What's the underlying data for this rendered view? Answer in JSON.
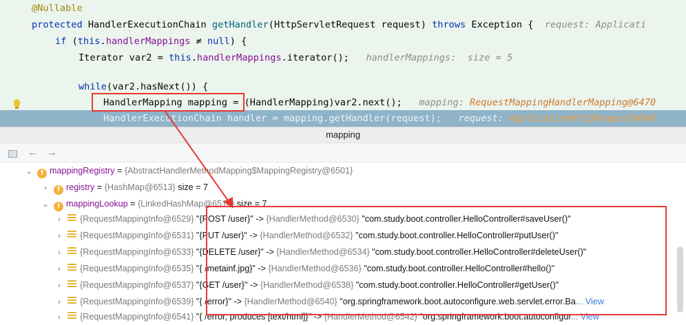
{
  "editor": {
    "annotation": "@Nullable",
    "method_sig": {
      "modifier": "protected",
      "return_type": "HandlerExecutionChain",
      "name": "getHandler",
      "params": "(HttpServletRequest request)",
      "throws_kw": "throws",
      "exception": "Exception {",
      "hint": "request: Applicati"
    },
    "if_line": {
      "kw_if": "if",
      "open": "(",
      "this_kw": "this",
      "dot": ".",
      "field": "handlerMappings",
      "op": " ≠ ",
      "null_kw": "null",
      "close": ") {"
    },
    "iter_line": {
      "code_pre": "Iterator var2 = ",
      "this_kw": "this",
      "dot": ".",
      "field": "handlerMappings",
      "code_post": ".iterator();",
      "hint": "handlerMappings:  size = 5"
    },
    "while_line": {
      "kw": "while",
      "code": "(var2.hasNext()) {"
    },
    "mapping_line": {
      "boxed": "HandlerMapping mapping",
      "code": " = (HandlerMapping)var2.next();",
      "hint_label": "mapping: ",
      "hint_value": "RequestMappingHandlerMapping@6470"
    },
    "current_line": {
      "code": "HandlerExecutionChain handler = mapping.getHandler(request);",
      "hint_label": "request: ",
      "hint_value": "ApplicationHttpRequest@648"
    }
  },
  "popup": {
    "title": "mapping",
    "back_glyph": "←",
    "forward_glyph": "→"
  },
  "tree": {
    "expanded_glyph": "⌄",
    "collapsed_glyph": "›",
    "field_badge": "f",
    "registry_root": {
      "name": "mappingRegistry",
      "eq": " = ",
      "value": "{AbstractHandlerMethodMapping$MappingRegistry@6501}"
    },
    "registry": {
      "name": "registry",
      "eq": " = ",
      "value": "{HashMap@6513}",
      "size": "  size = 7"
    },
    "lookup": {
      "name": "mappingLookup",
      "eq": " = ",
      "value": "{LinkedHashMap@6514}",
      "size": "  size = 7"
    },
    "entries": [
      {
        "key": "{RequestMappingInfo@6529}",
        "path": " \"{POST /user}\"",
        "arrow": " -> ",
        "handler": "{HandlerMethod@6530}",
        "target": " \"com.study.boot.controller.HelloController#saveUser()\"",
        "view": ""
      },
      {
        "key": "{RequestMappingInfo@6531}",
        "path": " \"{PUT /user}\"",
        "arrow": " -> ",
        "handler": "{HandlerMethod@6532}",
        "target": " \"com.study.boot.controller.HelloController#putUser()\"",
        "view": ""
      },
      {
        "key": "{RequestMappingInfo@6533}",
        "path": " \"{DELETE /user}\"",
        "arrow": " -> ",
        "handler": "{HandlerMethod@6534}",
        "target": " \"com.study.boot.controller.HelloController#deleteUser()\"",
        "view": ""
      },
      {
        "key": "{RequestMappingInfo@6535}",
        "path": " \"{ /metainf.jpg}\"",
        "arrow": " -> ",
        "handler": "{HandlerMethod@6536}",
        "target": " \"com.study.boot.controller.HelloController#hello()\"",
        "view": ""
      },
      {
        "key": "{RequestMappingInfo@6537}",
        "path": " \"{GET /user}\"",
        "arrow": " -> ",
        "handler": "{HandlerMethod@6538}",
        "target": " \"com.study.boot.controller.HelloController#getUser()\"",
        "view": ""
      },
      {
        "key": "{RequestMappingInfo@6539}",
        "path": " \"{ /error}\"",
        "arrow": " -> ",
        "handler": "{HandlerMethod@6540}",
        "target": " \"org.springframework.boot.autoconfigure.web.servlet.error.Ba",
        "view": "... View"
      },
      {
        "key": "{RequestMappingInfo@6541}",
        "path": " \"{ /error, produces [text/html]}\"",
        "arrow": " -> ",
        "handler": "{HandlerMethod@6542}",
        "target": " \"org.springframework.boot.autoconfigur",
        "view": "... View"
      }
    ]
  },
  "colors": {
    "highlight_box": "#e53935",
    "editor_bg": "#ebf4ed",
    "current_line_bg": "#8fb3c8"
  }
}
